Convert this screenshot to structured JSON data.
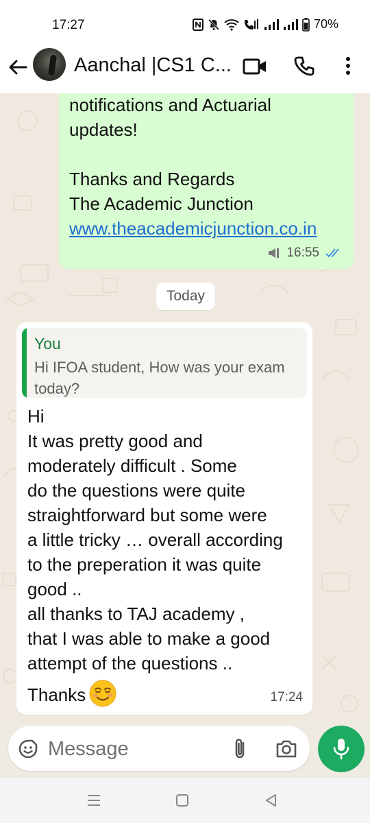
{
  "status_bar": {
    "time": "17:27",
    "battery": "70%",
    "icons": [
      "nfc-icon",
      "mute-icon",
      "wifi-icon",
      "wifi-calling-icon",
      "signal-icon",
      "signal-icon",
      "battery-icon"
    ]
  },
  "header": {
    "contact_name": "Aanchal |CS1 C...",
    "icons": [
      "back-arrow-icon",
      "video-call-icon",
      "phone-icon",
      "more-vert-icon"
    ]
  },
  "messages": {
    "outgoing": {
      "lines": [
        "notifications and Actuarial",
        "updates!",
        "",
        "Thanks and Regards",
        "The Academic Junction"
      ],
      "link": "www.theacademicjunction.co.in",
      "time": "16:55",
      "status": "read"
    },
    "date_divider": "Today",
    "incoming": {
      "quote_author": "You",
      "quote_text": "Hi IFOA student, How was your exam today?",
      "lines": [
        "Hi",
        "It was pretty good and",
        "moderately difficult . Some",
        "do the questions were quite",
        "straightforward but some were",
        "a little tricky … overall according",
        "to the preperation it was quite",
        "good ..",
        "all thanks to TAJ academy ,",
        "that I was able to make a good",
        "attempt of the questions ..",
        "Thanks"
      ],
      "emoji": "smiling-face-emoji",
      "time": "17:24"
    }
  },
  "composer": {
    "placeholder": "Message",
    "icons": [
      "emoji-icon",
      "attach-icon",
      "camera-icon",
      "mic-icon"
    ]
  },
  "nav_bar": {
    "icons": [
      "recents-icon",
      "home-icon",
      "back-icon"
    ]
  },
  "colors": {
    "outgoing_bubble": "#d9fdd3",
    "accent_green": "#1daa61",
    "link_blue": "#1c6fd0",
    "read_ticks": "#3b8fe0"
  }
}
